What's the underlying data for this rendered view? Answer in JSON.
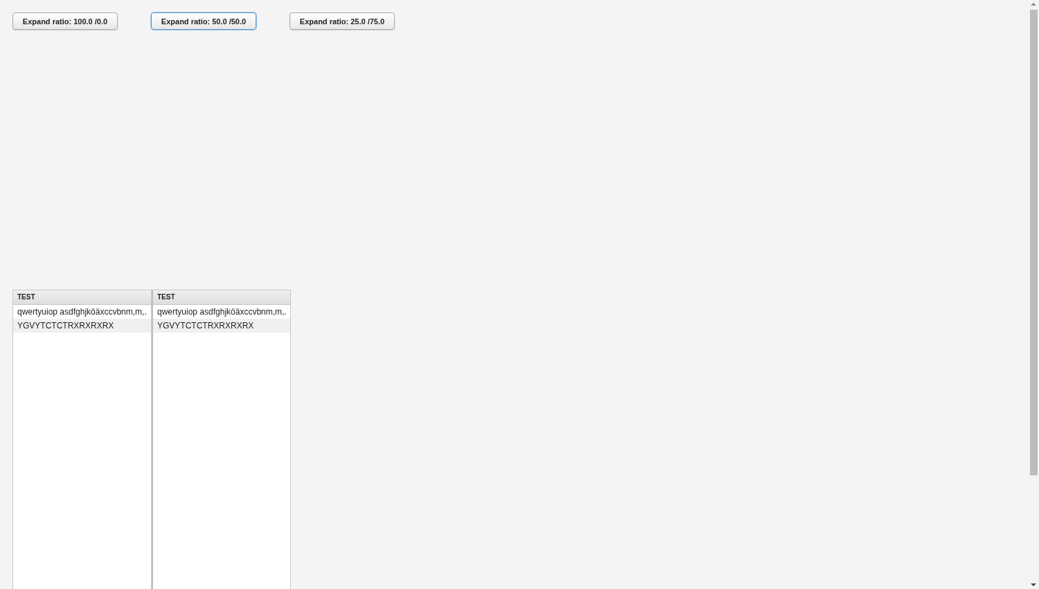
{
  "buttons": [
    {
      "label": "Expand ratio: 100.0 /0.0",
      "focused": false
    },
    {
      "label": "Expand ratio: 50.0 /50.0",
      "focused": true
    },
    {
      "label": "Expand ratio: 25.0 /75.0",
      "focused": false
    }
  ],
  "tables": [
    {
      "header": "TEST",
      "rows": [
        "qwertyuiop asdfghjköäxccvbnm,m,.",
        "YGVYTCTCTRXRXRXRX"
      ]
    },
    {
      "header": "TEST",
      "rows": [
        "qwertyuiop asdfghjköäxccvbnm,m,.",
        "YGVYTCTCTRXRXRXRX"
      ]
    }
  ]
}
